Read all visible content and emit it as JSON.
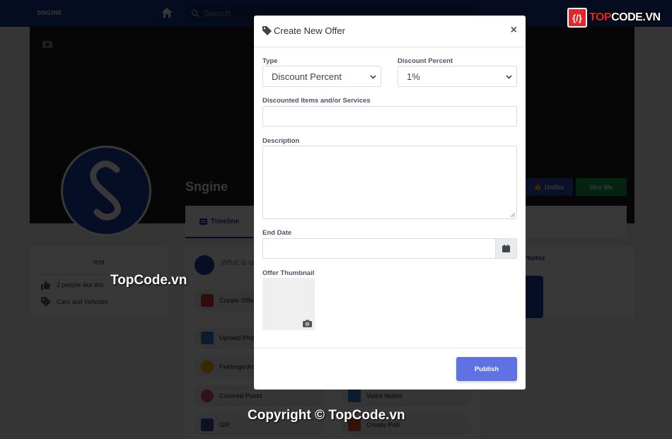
{
  "app": {
    "brand": "SNGINE",
    "search_placeholder": "Search",
    "nav_icons": [
      "home-icon",
      "friends-icon",
      "messages-icon",
      "notifications-icon"
    ]
  },
  "profile": {
    "name": "Sngine",
    "buttons": {
      "unlike": "Unlike",
      "hire": "Hire Me"
    },
    "tabs": [
      {
        "label": "Timeline",
        "icon": "newspaper-icon",
        "active": true
      }
    ],
    "about": {
      "text": "test",
      "likes": "2 people like this",
      "category": "Cars and Vehicles"
    },
    "photos_title": "Photos"
  },
  "composer": {
    "placeholder": "What is on your mind?",
    "actions": [
      {
        "label": "Create Offer",
        "icon": "shopping-bag-icon",
        "color": "#d9363e"
      },
      {
        "label": "Upload Photos",
        "icon": "camera-icon",
        "color": "#2f7fd0"
      },
      {
        "label": "Feelings/Activity",
        "icon": "smile-icon",
        "color": "#f2c20f"
      },
      {
        "label": "Colored Posts",
        "icon": "color-wheel-icon",
        "color": "#e44d7b"
      },
      {
        "label": "Voice Notes",
        "icon": "microphone-icon",
        "color": "#2f7fd0"
      },
      {
        "label": "GIF",
        "icon": "gif-icon",
        "color": "#3a4fa0"
      },
      {
        "label": "Create Poll",
        "icon": "poll-icon",
        "color": "#e4572e"
      }
    ]
  },
  "modal": {
    "title": "Create New Offer",
    "title_icon": "tag-icon",
    "close_label": "×",
    "fields": {
      "type": {
        "label": "Type",
        "value": "Discount Percent"
      },
      "discount_percent": {
        "label": "Discount Percent",
        "value": "1%"
      },
      "discounted_items": {
        "label": "Discounted Items and/or Services",
        "value": ""
      },
      "description": {
        "label": "Description",
        "value": ""
      },
      "end_date": {
        "label": "End Date",
        "value": ""
      },
      "thumbnail": {
        "label": "Offer Thumbnail"
      }
    },
    "publish_label": "Publish",
    "accent_color": "#5e72e4"
  },
  "watermarks": {
    "center": "TopCode.vn",
    "bottom": "Copyright © TopCode.vn",
    "logo_text_accent": "TOP",
    "logo_text_rest": "CODE.VN",
    "logo_glyph": "{/}"
  }
}
